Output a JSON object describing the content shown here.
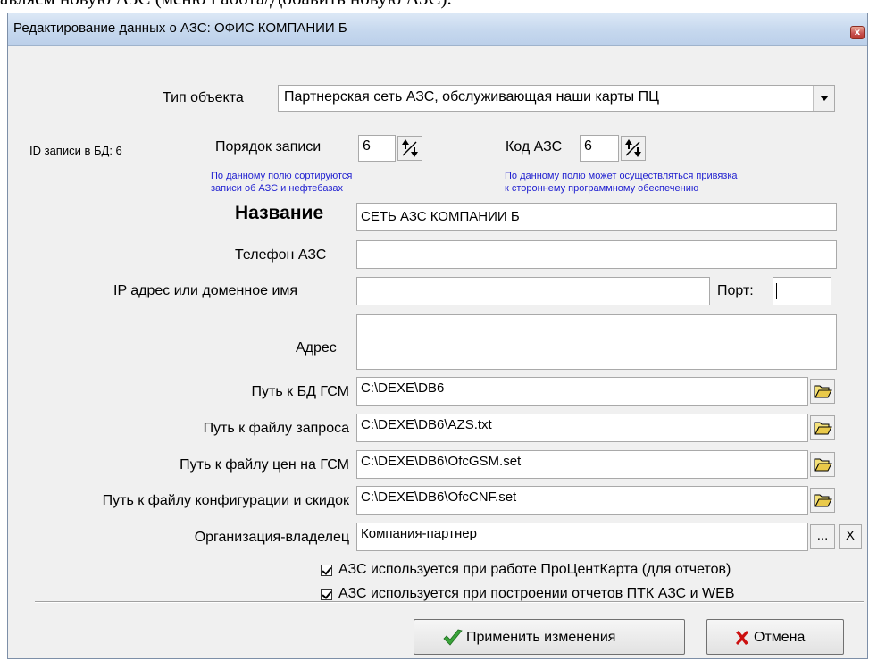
{
  "document": {
    "top_text": "авляем новую АЗС (меню Работа/Добавить новую АЗС)."
  },
  "window": {
    "title": "Редактирование данных о АЗС: ОФИС КОМПАНИИ Б",
    "close_label": "x"
  },
  "object_type": {
    "label": "Тип объекта",
    "value": "Партнерская сеть АЗС, обслуживающая наши карты ПЦ"
  },
  "record": {
    "id_label": "ID записи в БД: 6",
    "order_label": "Порядок записи",
    "order_value": "6",
    "order_hint_1": "По данному полю сортируются",
    "order_hint_2": "записи об АЗС и нефтебазах",
    "code_label": "Код АЗС",
    "code_value": "6",
    "code_hint_1": "По данному полю может осуществляться привязка",
    "code_hint_2": "к стороннему программному обеспечению"
  },
  "fields": {
    "name_label": "Название",
    "name_value": "СЕТЬ АЗС КОМПАНИИ Б",
    "phone_label": "Телефон АЗС",
    "phone_value": "",
    "ip_label": "IP адрес или доменное имя",
    "ip_value": "",
    "port_label": "Порт:",
    "port_value": "",
    "address_label": "Адрес",
    "address_value": "",
    "db_path_label": "Путь к БД ГСМ",
    "db_path_value": "C:\\DEXE\\DB6",
    "request_path_label": "Путь к файлу запроса",
    "request_path_value": "C:\\DEXE\\DB6\\AZS.txt",
    "prices_path_label": "Путь к файлу цен на ГСМ",
    "prices_path_value": "C:\\DEXE\\DB6\\OfcGSM.set",
    "config_path_label": "Путь к файлу конфигурации и скидок",
    "config_path_value": "C:\\DEXE\\DB6\\OfcCNF.set",
    "owner_label": "Организация-владелец",
    "owner_value": "Компания-партнер",
    "owner_browse": "...",
    "owner_clear": "X"
  },
  "checkboxes": [
    {
      "label": "АЗС используется при работе ПроЦентКарта (для отчетов)",
      "checked": true
    },
    {
      "label": "АЗС используется при построении отчетов ПТК АЗС и WEB",
      "checked": true
    }
  ],
  "buttons": {
    "apply": "Применить изменения",
    "cancel": "Отмена"
  },
  "colors": {
    "hint": "#1f1fd0",
    "apply_check": "#3aa33a",
    "cancel_x": "#cc1010"
  }
}
